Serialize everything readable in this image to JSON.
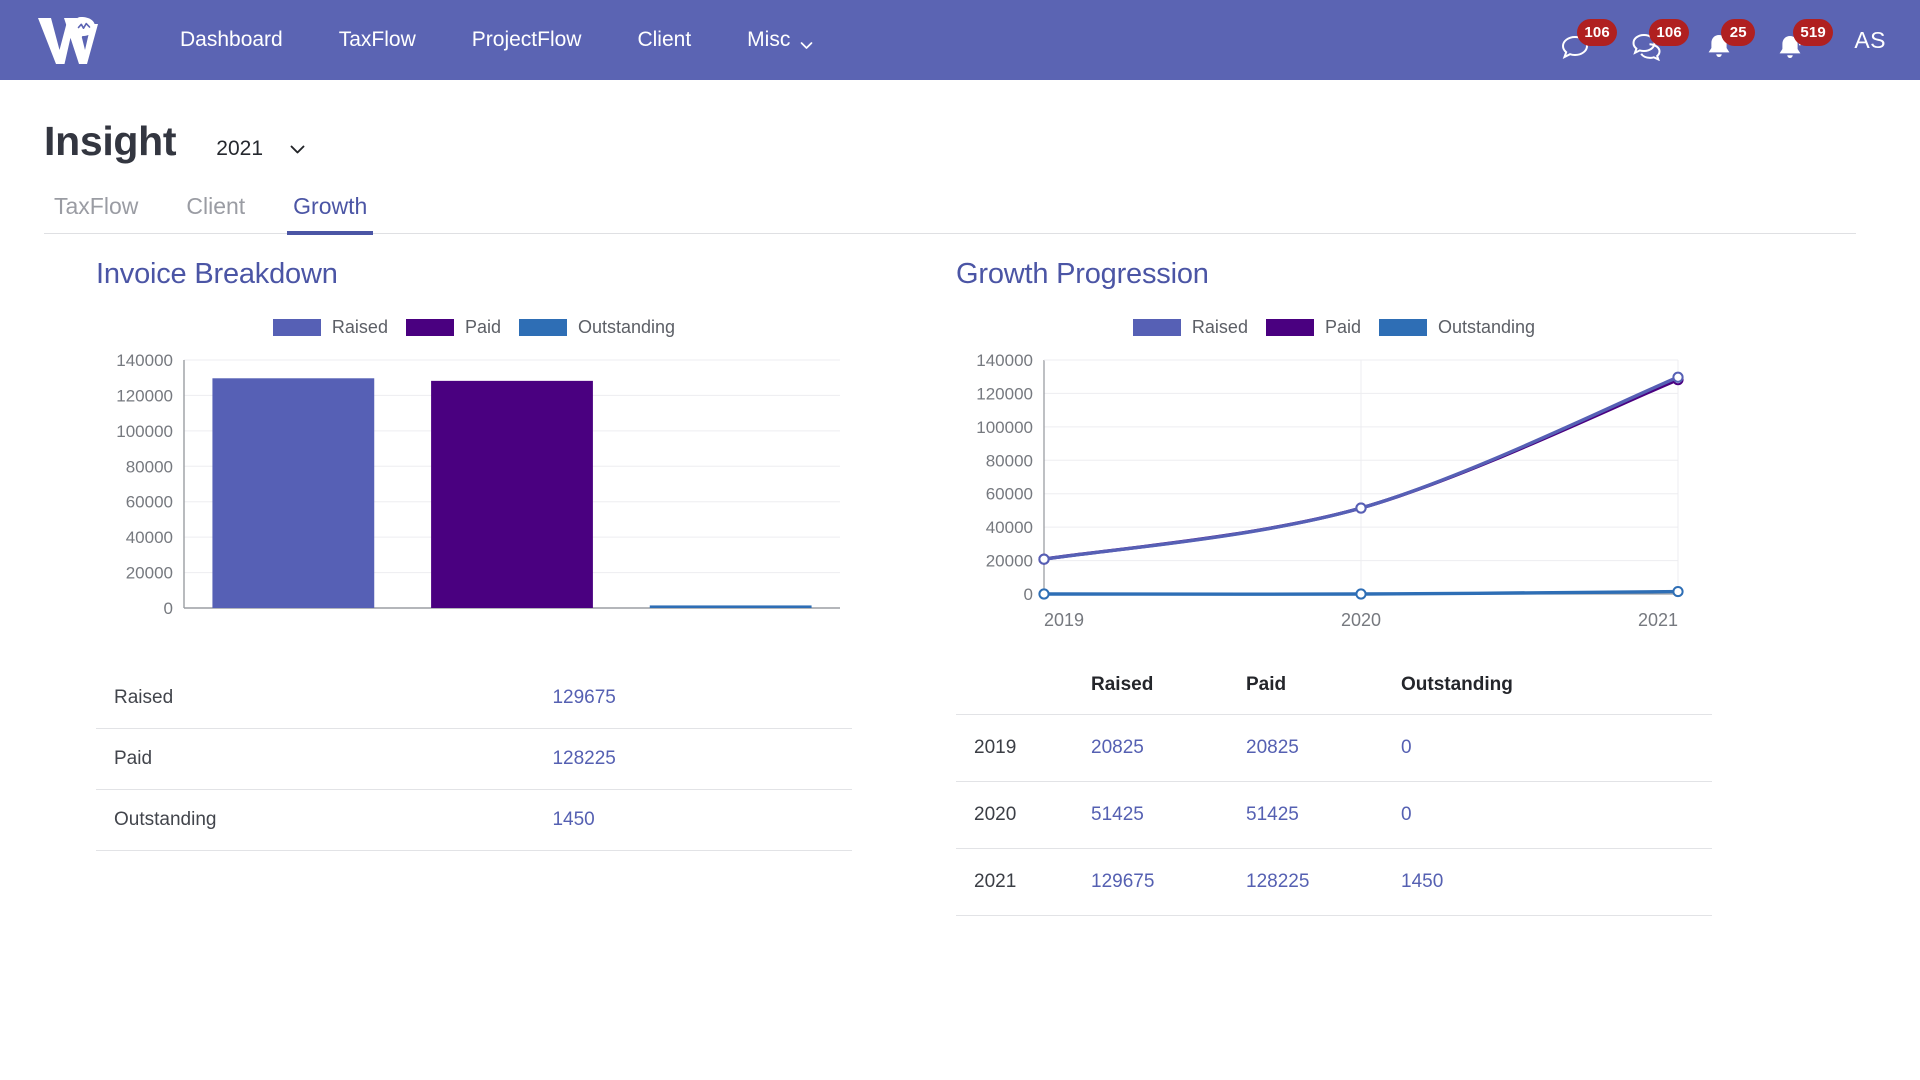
{
  "navbar": {
    "logo_name": "w-speech-bubble-logo",
    "links": [
      {
        "label": "Dashboard",
        "has_caret": false
      },
      {
        "label": "TaxFlow",
        "has_caret": false
      },
      {
        "label": "ProjectFlow",
        "has_caret": false
      },
      {
        "label": "Client",
        "has_caret": false
      },
      {
        "label": "Misc",
        "has_caret": true
      }
    ],
    "notifications": [
      {
        "icon": "chat-bubble-icon",
        "count": "106"
      },
      {
        "icon": "chat-bubbles-icon",
        "count": "106"
      },
      {
        "icon": "bell-icon",
        "count": "25"
      },
      {
        "icon": "bell-ringing-icon",
        "count": "519"
      }
    ],
    "avatar_initials": "AS",
    "background_color": "#5b64b3",
    "badge_color": "#b02020"
  },
  "header": {
    "title": "Insight",
    "year_selected": "2021"
  },
  "tabs": [
    {
      "label": "TaxFlow",
      "active": false
    },
    {
      "label": "Client",
      "active": false
    },
    {
      "label": "Growth",
      "active": true
    }
  ],
  "colors": {
    "raised": "#5660b5",
    "paid": "#4a0080",
    "outstanding": "#2e6eb5",
    "accent": "#4b55a5",
    "value_text": "#5560b2"
  },
  "legend": [
    {
      "label": "Raised",
      "color": "#5660b5"
    },
    {
      "label": "Paid",
      "color": "#4a0080"
    },
    {
      "label": "Outstanding",
      "color": "#2e6eb5"
    }
  ],
  "invoice_panel": {
    "title": "Invoice Breakdown",
    "rows": [
      {
        "label": "Raised",
        "value": "129675"
      },
      {
        "label": "Paid",
        "value": "128225"
      },
      {
        "label": "Outstanding",
        "value": "1450"
      }
    ]
  },
  "growth_panel": {
    "title": "Growth Progression",
    "columns": [
      "",
      "Raised",
      "Paid",
      "Outstanding"
    ],
    "rows": [
      {
        "year": "2019",
        "raised": "20825",
        "paid": "20825",
        "outstanding": "0"
      },
      {
        "year": "2020",
        "raised": "51425",
        "paid": "51425",
        "outstanding": "0"
      },
      {
        "year": "2021",
        "raised": "129675",
        "paid": "128225",
        "outstanding": "1450"
      }
    ]
  },
  "chart_data": [
    {
      "type": "bar",
      "title": "Invoice Breakdown",
      "categories": [
        "Raised",
        "Paid",
        "Outstanding"
      ],
      "values": [
        129675,
        128225,
        1450
      ],
      "colors": [
        "#5660b5",
        "#4a0080",
        "#2e6eb5"
      ],
      "xlabel": "",
      "ylabel": "",
      "ylim": [
        0,
        140000
      ],
      "yticks": [
        0,
        20000,
        40000,
        60000,
        80000,
        100000,
        120000,
        140000
      ],
      "ytick_labels": [
        "0",
        "20000",
        "40000",
        "60000",
        "80000",
        "100000",
        "120000",
        "140000"
      ],
      "grid": true,
      "legend": [
        "Raised",
        "Paid",
        "Outstanding"
      ],
      "legend_position": "top-center"
    },
    {
      "type": "line",
      "title": "Growth Progression",
      "x": [
        "2019",
        "2020",
        "2021"
      ],
      "series": [
        {
          "name": "Raised",
          "values": [
            20825,
            51425,
            129675
          ],
          "color": "#5660b5"
        },
        {
          "name": "Paid",
          "values": [
            20825,
            51425,
            128225
          ],
          "color": "#4a0080"
        },
        {
          "name": "Outstanding",
          "values": [
            0,
            0,
            1450
          ],
          "color": "#2e6eb5"
        }
      ],
      "xlabel": "",
      "ylabel": "",
      "ylim": [
        0,
        140000
      ],
      "yticks": [
        0,
        20000,
        40000,
        60000,
        80000,
        100000,
        120000,
        140000
      ],
      "ytick_labels": [
        "0",
        "20000",
        "40000",
        "60000",
        "80000",
        "100000",
        "120000",
        "140000"
      ],
      "xtick_labels": [
        "2019",
        "2020",
        "2021"
      ],
      "grid": true,
      "markers": true,
      "smooth": true,
      "legend": [
        "Raised",
        "Paid",
        "Outstanding"
      ],
      "legend_position": "top-center"
    }
  ]
}
